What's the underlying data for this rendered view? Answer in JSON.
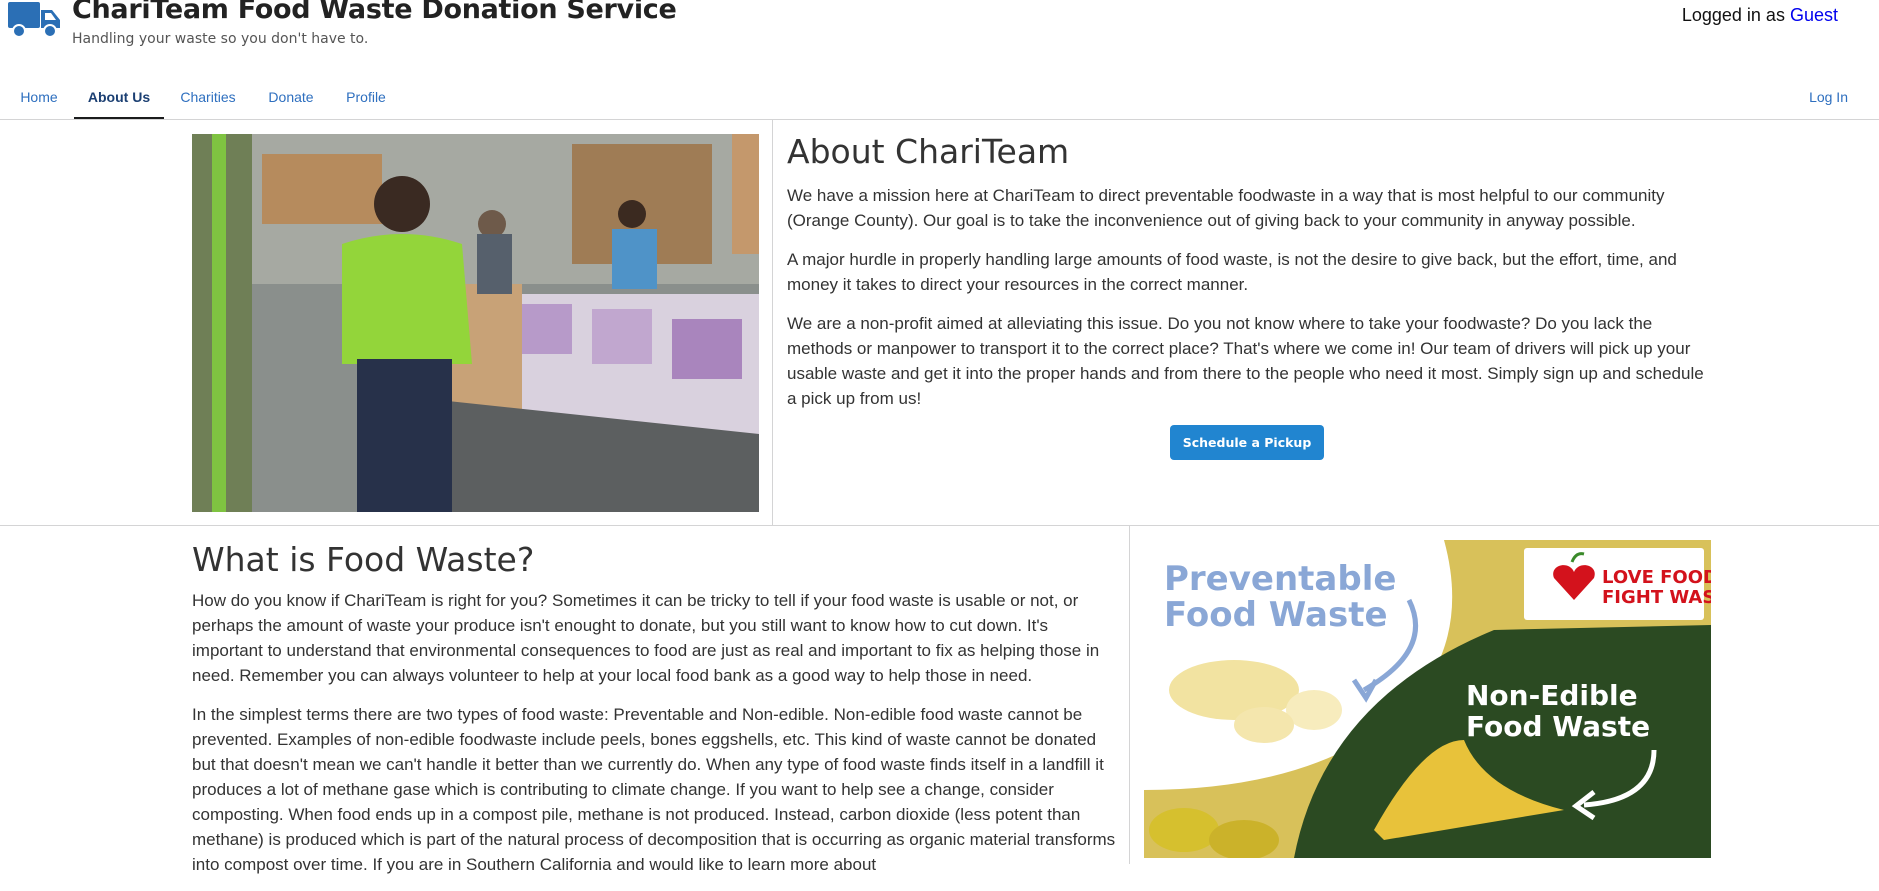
{
  "header": {
    "title": "ChariTeam Food Waste Donation Service",
    "tagline": "Handling your waste so you don't have to.",
    "login_prefix": "Logged in as",
    "login_user": "Guest"
  },
  "nav": {
    "items": [
      "Home",
      "About Us",
      "Charities",
      "Donate",
      "Profile"
    ],
    "active": "About Us",
    "login": "Log In"
  },
  "about": {
    "title": "About ChariTeam",
    "paragraphs": [
      "We have a mission here at ChariTeam to direct preventable foodwaste in a way that is most helpful to our community (Orange County). Our goal is to take the inconvenience out of giving back to your community in anyway possible.",
      "A major hurdle in properly handling large amounts of food waste, is not the desire to give back, but the effort, time, and money it takes to direct your resources in the correct manner.",
      "We are a non-profit aimed at alleviating this issue. Do you not know where to take your foodwaste? Do you lack the methods or manpower to transport it to the correct place? That's where we come in! Our team of drivers will pick up your usable waste and get it into the proper hands and from there to the people who need it most. Simply sign up and schedule a pick up from us!"
    ],
    "button": "Schedule a Pickup"
  },
  "food_waste": {
    "title": "What is Food Waste?",
    "paragraphs": [
      "How do you know if ChariTeam is right for you? Sometimes it can be tricky to tell if your food waste is usable or not, or perhaps the amount of waste your produce isn't enought to donate, but you still want to know how to cut down. It's important to understand that environmental consequences to food are just as real and important to fix as helping those in need. Remember you can always volunteer to help at your local food bank as a good way to help those in need.",
      "In the simplest terms there are two types of food waste: Preventable and Non-edible. Non-edible food waste cannot be prevented. Examples of non-edible foodwaste include peels, bones eggshells, etc. This kind of waste cannot be donated but that doesn't mean we can't handle it better than we currently do. When any type of food waste finds itself in a landfill it produces a lot of methane gase which is contributing to climate change. If you want to help see a change, consider composting. When food ends up in a compost pile, methane is not produced. Instead, carbon dioxide (less potent than methane) is produced which is part of the natural process of decomposition that is occurring as organic material transforms into compost over time. If you are in Southern California and would like to learn more about"
    ],
    "banner": {
      "preventable_line1": "Preventable",
      "preventable_line2": "Food Waste",
      "nonedible_line1": "Non-Edible",
      "nonedible_line2": "Food Waste",
      "logo_line1": "LOVE FOOD",
      "logo_line2": "FIGHT WASTE"
    }
  },
  "colors": {
    "button": "#2185d0",
    "link": "#2e6fbf",
    "logo_blue": "#2b6fb5",
    "banner_green": "#2b4a22",
    "banner_blue_text": "#8aa7d6",
    "banner_red": "#d3121c"
  }
}
